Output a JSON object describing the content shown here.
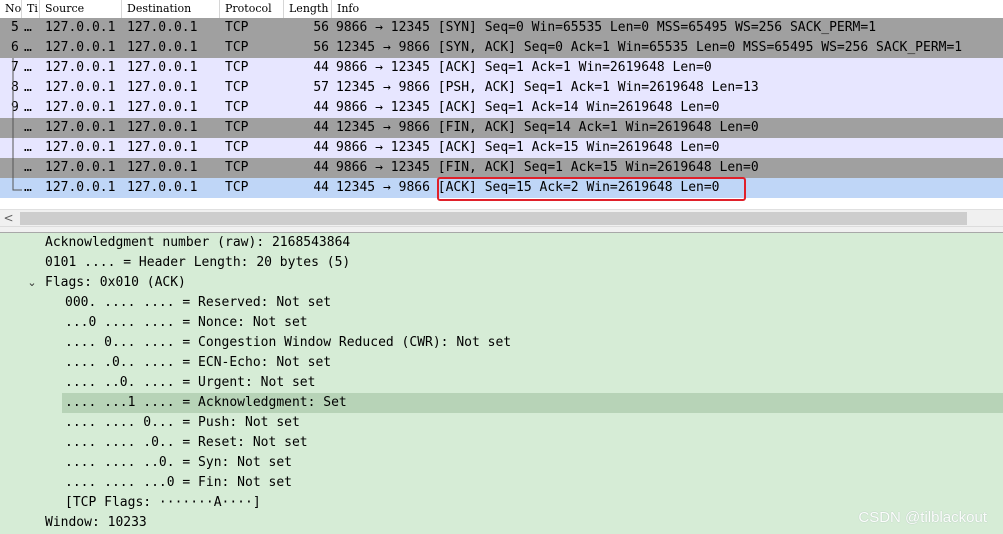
{
  "packet_list": {
    "columns": [
      "No",
      "Ti",
      "Source",
      "Destination",
      "Protocol",
      "Length",
      "Info"
    ],
    "rows": [
      {
        "no": "5",
        "ti": "…",
        "src": "127.0.0.1",
        "dst": "127.0.0.1",
        "proto": "TCP",
        "len": "56",
        "info": "9866 → 12345 [SYN] Seq=0 Win=65535 Len=0 MSS=65495 WS=256 SACK_PERM=1",
        "bg": "#a0a0a0"
      },
      {
        "no": "6",
        "ti": "…",
        "src": "127.0.0.1",
        "dst": "127.0.0.1",
        "proto": "TCP",
        "len": "56",
        "info": "12345 → 9866 [SYN, ACK] Seq=0 Ack=1 Win=65535 Len=0 MSS=65495 WS=256 SACK_PERM=1",
        "bg": "#a0a0a0"
      },
      {
        "no": "7",
        "ti": "…",
        "src": "127.0.0.1",
        "dst": "127.0.0.1",
        "proto": "TCP",
        "len": "44",
        "info": "9866 → 12345 [ACK] Seq=1 Ack=1 Win=2619648 Len=0",
        "bg": "#e7e6ff"
      },
      {
        "no": "8",
        "ti": "…",
        "src": "127.0.0.1",
        "dst": "127.0.0.1",
        "proto": "TCP",
        "len": "57",
        "info": "12345 → 9866 [PSH, ACK] Seq=1 Ack=1 Win=2619648 Len=13",
        "bg": "#e7e6ff"
      },
      {
        "no": "9",
        "ti": "…",
        "src": "127.0.0.1",
        "dst": "127.0.0.1",
        "proto": "TCP",
        "len": "44",
        "info": "9866 → 12345 [ACK] Seq=1 Ack=14 Win=2619648 Len=0",
        "bg": "#e7e6ff"
      },
      {
        "no": "",
        "ti": "…",
        "src": "127.0.0.1",
        "dst": "127.0.0.1",
        "proto": "TCP",
        "len": "44",
        "info": "12345 → 9866 [FIN, ACK] Seq=14 Ack=1 Win=2619648 Len=0",
        "bg": "#a0a0a0"
      },
      {
        "no": "",
        "ti": "…",
        "src": "127.0.0.1",
        "dst": "127.0.0.1",
        "proto": "TCP",
        "len": "44",
        "info": "9866 → 12345 [ACK] Seq=1 Ack=15 Win=2619648 Len=0",
        "bg": "#e7e6ff"
      },
      {
        "no": "",
        "ti": "…",
        "src": "127.0.0.1",
        "dst": "127.0.0.1",
        "proto": "TCP",
        "len": "44",
        "info": "9866 → 12345 [FIN, ACK] Seq=1 Ack=15 Win=2619648 Len=0",
        "bg": "#a0a0a0"
      },
      {
        "no": "",
        "ti": "…",
        "src": "127.0.0.1",
        "dst": "127.0.0.1",
        "proto": "TCP",
        "len": "44",
        "info": "12345 → 9866 [ACK] Seq=15 Ack=2 Win=2619648 Len=0",
        "bg": "#bfd6f7",
        "selected": true
      }
    ]
  },
  "detail_pane": {
    "lines": [
      {
        "text": "Acknowledgment number (raw): 2168543864",
        "indent": 0
      },
      {
        "text": "0101 .... = Header Length: 20 bytes (5)",
        "indent": 0
      },
      {
        "text": "Flags: 0x010 (ACK)",
        "indent": 0,
        "expander": "⌄"
      },
      {
        "text": "000. .... .... = Reserved: Not set",
        "indent": 1
      },
      {
        "text": "...0 .... .... = Nonce: Not set",
        "indent": 1
      },
      {
        "text": ".... 0... .... = Congestion Window Reduced (CWR): Not set",
        "indent": 1
      },
      {
        "text": ".... .0.. .... = ECN-Echo: Not set",
        "indent": 1
      },
      {
        "text": ".... ..0. .... = Urgent: Not set",
        "indent": 1
      },
      {
        "text": ".... ...1 .... = Acknowledgment: Set",
        "indent": 1,
        "selected": true
      },
      {
        "text": ".... .... 0... = Push: Not set",
        "indent": 1
      },
      {
        "text": ".... .... .0.. = Reset: Not set",
        "indent": 1
      },
      {
        "text": ".... .... ..0. = Syn: Not set",
        "indent": 1
      },
      {
        "text": ".... .... ...0 = Fin: Not set",
        "indent": 1
      },
      {
        "text": "[TCP Flags: ·······A····]",
        "indent": 1
      },
      {
        "text": "Window: 10233",
        "indent": 0
      }
    ]
  },
  "scrollbar": {
    "left_arrow": "<"
  },
  "watermark": "CSDN @tilblackout",
  "colors": {
    "highlight_box": "#e0202a",
    "detail_bg": "#d6ecd6"
  }
}
